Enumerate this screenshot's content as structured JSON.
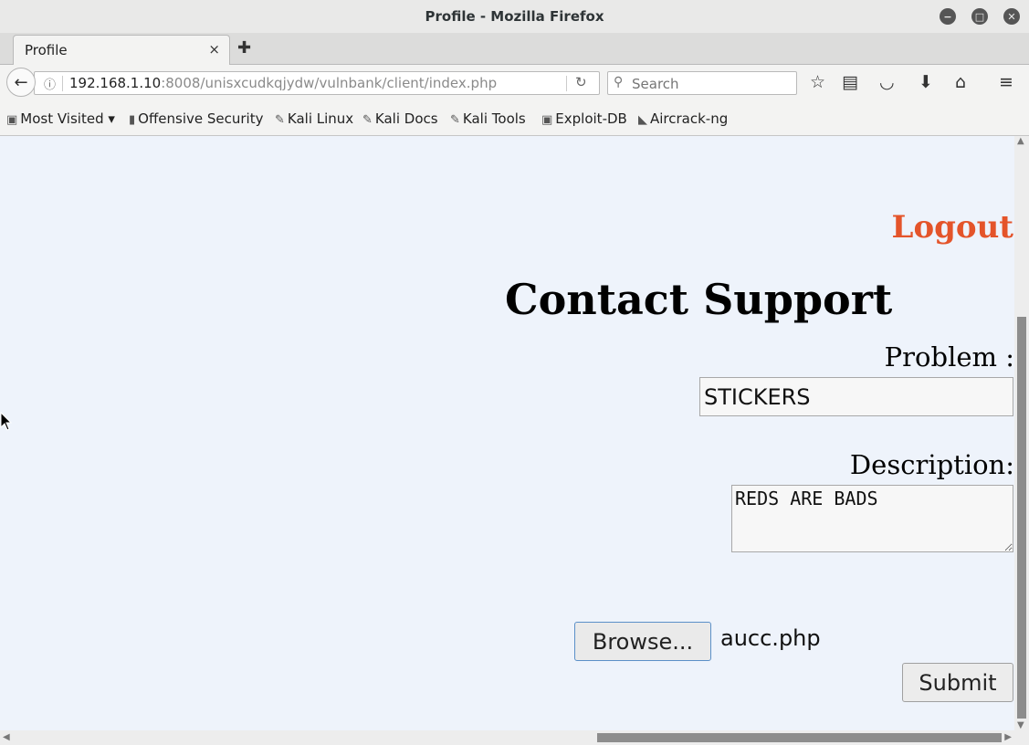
{
  "window": {
    "title": "Profile - Mozilla Firefox",
    "minimize_glyph": "−",
    "maximize_glyph": "□",
    "close_glyph": "✕"
  },
  "tabs": [
    {
      "label": "Profile",
      "close_glyph": "×",
      "active": true
    }
  ],
  "new_tab_glyph": "✚",
  "navbar": {
    "back_glyph": "←",
    "info_glyph": "ⓘ",
    "url_host": "192.168.1.10",
    "url_rest": ":8008/unisxcudkqjydw/vulnbank/client/index.php",
    "reload_glyph": "↻",
    "search_placeholder": "Search",
    "search_glyph": "⚲",
    "icons": [
      "bookmark-star-icon",
      "reading-list-icon",
      "pocket-icon",
      "downloads-icon",
      "home-icon",
      "menu-icon"
    ],
    "icon_glyphs": {
      "star": "☆",
      "library": "▤",
      "pocket": "◡",
      "download": "⬇",
      "home": "⌂",
      "menu": "≡"
    }
  },
  "bookmarks": [
    {
      "label": "Most Visited ▾",
      "icon": "most-visited-icon",
      "glyph": "▣"
    },
    {
      "label": "Offensive Security",
      "icon": "offsec-icon",
      "glyph": "▮"
    },
    {
      "label": "Kali Linux",
      "icon": "kali-icon",
      "glyph": "✎"
    },
    {
      "label": "Kali Docs",
      "icon": "kali-icon",
      "glyph": "✎"
    },
    {
      "label": "Kali Tools",
      "icon": "kali-icon",
      "glyph": "✎"
    },
    {
      "label": "Exploit-DB",
      "icon": "exploitdb-icon",
      "glyph": "▣"
    },
    {
      "label": "Aircrack-ng",
      "icon": "aircrack-icon",
      "glyph": "◣"
    }
  ],
  "page": {
    "logout_label": "Logout",
    "heading": "Contact Support",
    "problem_label": "Problem :",
    "problem_value": "STICKERS",
    "description_label": "Description:",
    "description_value": "REDS ARE BADS",
    "browse_label": "Browse...",
    "file_name": "aucc.php",
    "submit_label": "Submit",
    "cursor_glyph": "➤"
  },
  "colors": {
    "page_bg": "#eef3fb",
    "logout": "#e4542a",
    "chrome_bg": "#f3f3f2"
  },
  "scrollbars": {
    "up_glyph": "▲",
    "down_glyph": "▼",
    "left_glyph": "◀",
    "right_glyph": "▶"
  }
}
